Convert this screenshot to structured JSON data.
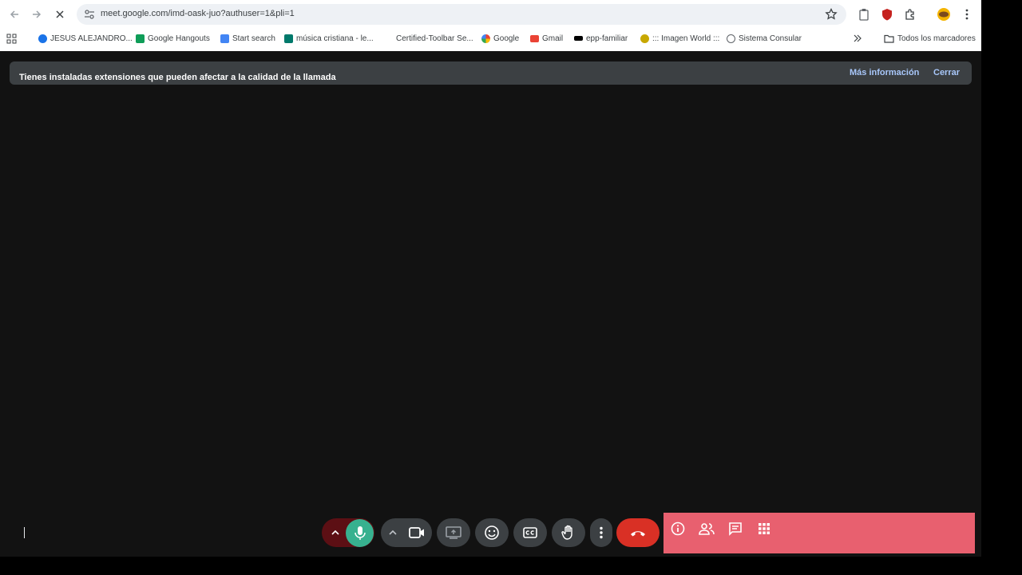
{
  "browser": {
    "url": "meet.google.com/imd-oask-juo?authuser=1&pli=1",
    "bookmarks": [
      {
        "label": "JESUS ALEJANDRO...",
        "icon": "refresh-favicon",
        "color": "#1a73e8"
      },
      {
        "label": "Google Hangouts",
        "icon": "hangouts-favicon",
        "color": "#0f9d58"
      },
      {
        "label": "Start search",
        "icon": "search-favicon",
        "color": "#4285f4"
      },
      {
        "label": "música cristiana - le...",
        "icon": "music-favicon",
        "color": "#00796b"
      },
      {
        "label": "Certified-Toolbar Se...",
        "icon": "blank-favicon",
        "color": "#ffffff"
      },
      {
        "label": "Google",
        "icon": "google-favicon",
        "color": "#4285f4"
      },
      {
        "label": "Gmail",
        "icon": "gmail-favicon",
        "color": "#ea4335"
      },
      {
        "label": "epp-familiar",
        "icon": "wix-favicon",
        "color": "#000000"
      },
      {
        "label": "::: Imagen World :::",
        "icon": "imagen-favicon",
        "color": "#c8a800"
      },
      {
        "label": "Sistema Consular",
        "icon": "seal-favicon",
        "color": "#5f6368"
      }
    ],
    "all_bookmarks": "Todos los marcadores"
  },
  "banner": {
    "text": "Tienes instaladas extensiones que pueden afectar a la calidad de la llamada",
    "more_info": "Más información",
    "close": "Cerrar"
  },
  "colors": {
    "background": "#121212",
    "mic_active": "#37b18f",
    "end_call": "#d93025",
    "side_panel": "#e8606f",
    "banner": "#3c4043"
  }
}
